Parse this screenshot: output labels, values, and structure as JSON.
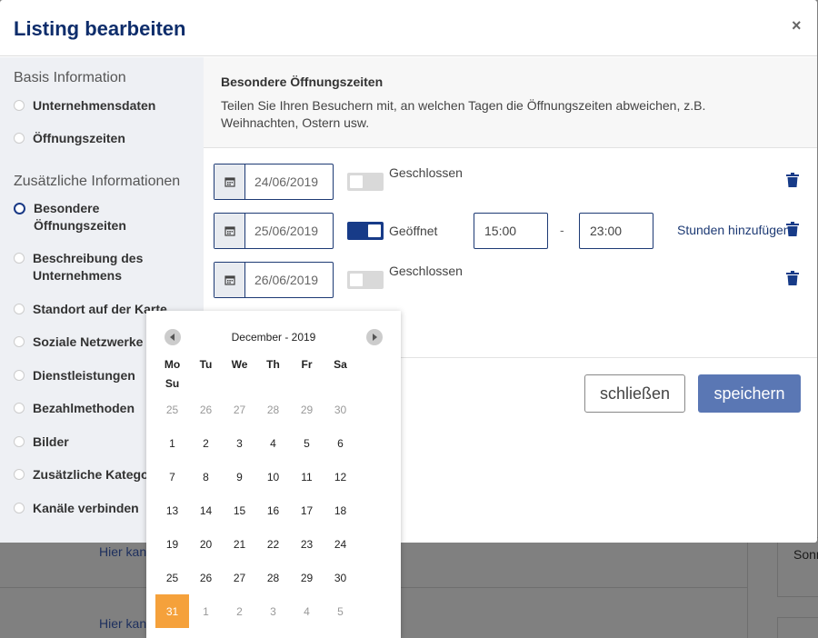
{
  "modal": {
    "title": "Listing bearbeiten",
    "close_symbol": "×"
  },
  "sidebar": {
    "basis_heading": "Basis Information",
    "basis_items": [
      {
        "label": "Unternehmensdaten"
      },
      {
        "label": "Öffnungszeiten"
      }
    ],
    "extra_heading": "Zusätzliche Informationen",
    "extra_items": [
      {
        "label": "Besondere Öffnungszeiten",
        "active": true
      },
      {
        "label": "Beschreibung des Unternehmens"
      },
      {
        "label": "Standort auf der Karte"
      },
      {
        "label": "Soziale Netzwerke"
      },
      {
        "label": "Dienstleistungen"
      },
      {
        "label": "Bezahlmethoden"
      },
      {
        "label": "Bilder"
      },
      {
        "label": "Zusätzliche Kategorien"
      },
      {
        "label": "Kanäle verbinden"
      }
    ]
  },
  "main": {
    "title": "Besondere Öffnungszeiten",
    "description": "Teilen Sie Ihren Besuchern mit, an welchen Tagen die Öffnungszeiten abweichen, z.B. Weihnachten, Ostern usw.",
    "rows": [
      {
        "date": "24/06/2019",
        "open": false,
        "status_label": "Geschlossen"
      },
      {
        "date": "25/06/2019",
        "open": true,
        "status_label": "Geöffnet",
        "from": "15:00",
        "to": "23:00",
        "dash": "-",
        "add_hours": "Stunden hinzufügen"
      },
      {
        "date": "26/06/2019",
        "open": false,
        "status_label": "Geschlossen"
      }
    ]
  },
  "buttons": {
    "close_label": "schließen",
    "save_label": "speichern"
  },
  "datepicker": {
    "month_label": "December - 2019",
    "weekdays": [
      "Mo",
      "Tu",
      "We",
      "Th",
      "Fr",
      "Sa",
      "Su"
    ],
    "weeks": [
      [
        "25",
        "26",
        "27",
        "28",
        "29",
        "30"
      ],
      [
        "1",
        "2",
        "3",
        "4",
        "5",
        "6"
      ],
      [
        "7",
        "8",
        "9",
        "10",
        "11",
        "12"
      ],
      [
        "13",
        "14",
        "15",
        "16",
        "17",
        "18"
      ],
      [
        "19",
        "20",
        "21",
        "22",
        "23",
        "24"
      ],
      [
        "25",
        "26",
        "27",
        "28",
        "29",
        "30"
      ],
      [
        "31",
        "1",
        "2",
        "3",
        "4",
        "5"
      ]
    ],
    "selected": "31",
    "colors": {
      "selected": "#f5a13b"
    }
  },
  "background": {
    "link_text_1": "Hier kan",
    "link_text_2": "Hier kan",
    "right_text": "Sonn"
  },
  "colors": {
    "brand": "#0e2d6b",
    "accent": "#173b88",
    "save_button": "#5a77b4"
  }
}
